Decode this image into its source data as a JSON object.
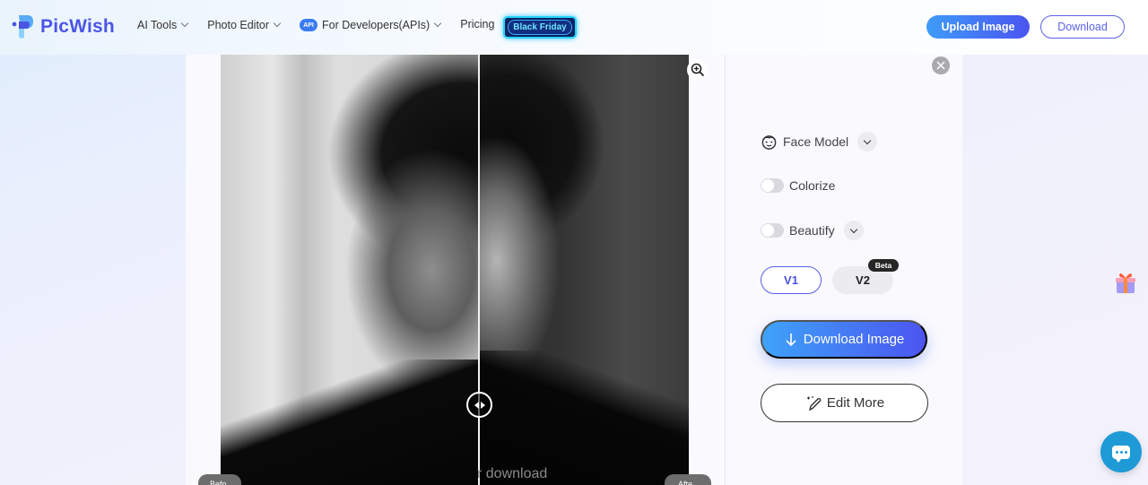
{
  "header": {
    "brand": "PicWish",
    "nav": [
      {
        "label": "AI Tools",
        "has_dropdown": true
      },
      {
        "label": "Photo Editor",
        "has_dropdown": true
      },
      {
        "label": "For Developers(APIs)",
        "has_dropdown": true,
        "badge": "API"
      },
      {
        "label": "Pricing",
        "has_dropdown": false
      }
    ],
    "promo_badge": "Black Friday",
    "upload_button": "Upload Image",
    "download_button": "Download"
  },
  "preview": {
    "before_label": "Befo",
    "after_label": "Afte",
    "overlay_text": "r download",
    "zoom_icon": "zoom-in-icon",
    "compare_position": 0.55
  },
  "panel": {
    "options": [
      {
        "label": "Face Model",
        "icon": "face-icon",
        "type": "dropdown"
      },
      {
        "label": "Colorize",
        "type": "toggle",
        "on": false
      },
      {
        "label": "Beautify",
        "type": "toggle",
        "on": false,
        "has_dropdown": true
      }
    ],
    "versions": [
      {
        "label": "V1",
        "selected": true
      },
      {
        "label": "V2",
        "selected": false,
        "badge": "Beta"
      }
    ],
    "download_button": "Download Image",
    "edit_button": "Edit More"
  },
  "colors": {
    "brand": "#4b55e6",
    "primary_gradient_start": "#3ea3f9",
    "primary_gradient_end": "#4b55f0",
    "chat": "#1e9ad6"
  }
}
